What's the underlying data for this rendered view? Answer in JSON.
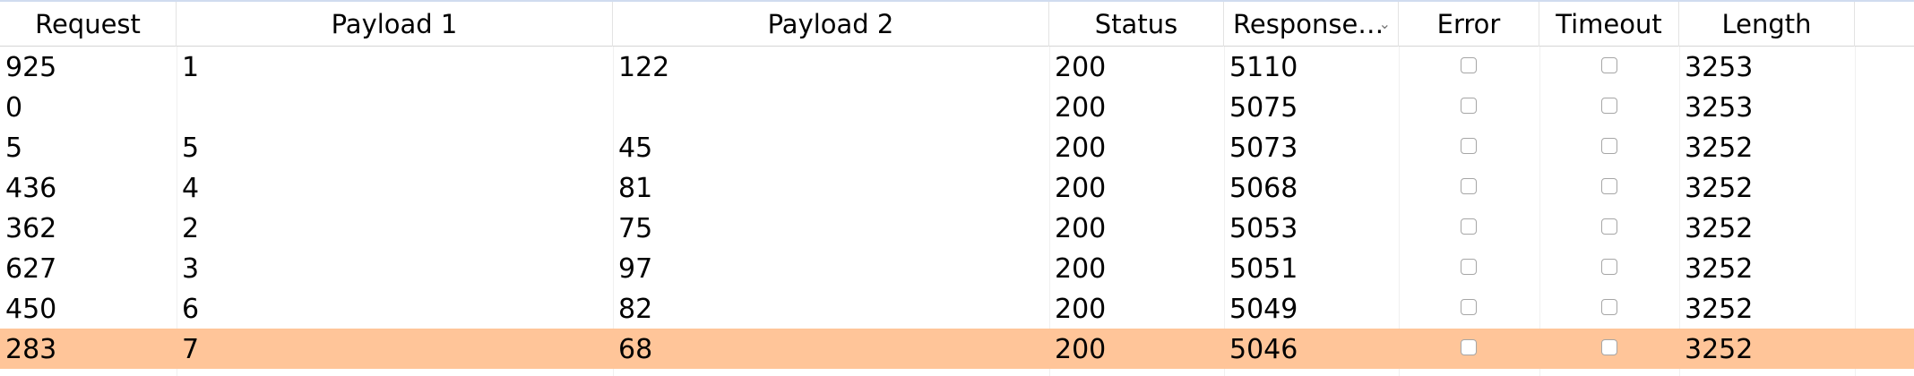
{
  "columns": [
    "Request",
    "Payload 1",
    "Payload 2",
    "Status",
    "Response…",
    "Error",
    "Timeout",
    "Length"
  ],
  "sort_icon": "chevron-down-icon",
  "selected_row_color": "#ffc599",
  "rows": [
    {
      "request": "925",
      "payload1": "1",
      "payload2": "122",
      "status": "200",
      "response": "5110",
      "error": false,
      "timeout": false,
      "length": "3253"
    },
    {
      "request": "0",
      "payload1": "",
      "payload2": "",
      "status": "200",
      "response": "5075",
      "error": false,
      "timeout": false,
      "length": "3253"
    },
    {
      "request": "5",
      "payload1": "5",
      "payload2": "45",
      "status": "200",
      "response": "5073",
      "error": false,
      "timeout": false,
      "length": "3252"
    },
    {
      "request": "436",
      "payload1": "4",
      "payload2": "81",
      "status": "200",
      "response": "5068",
      "error": false,
      "timeout": false,
      "length": "3252"
    },
    {
      "request": "362",
      "payload1": "2",
      "payload2": "75",
      "status": "200",
      "response": "5053",
      "error": false,
      "timeout": false,
      "length": "3252"
    },
    {
      "request": "627",
      "payload1": "3",
      "payload2": "97",
      "status": "200",
      "response": "5051",
      "error": false,
      "timeout": false,
      "length": "3252"
    },
    {
      "request": "450",
      "payload1": "6",
      "payload2": "82",
      "status": "200",
      "response": "5049",
      "error": false,
      "timeout": false,
      "length": "3252"
    },
    {
      "request": "283",
      "payload1": "7",
      "payload2": "68",
      "status": "200",
      "response": "5046",
      "error": false,
      "timeout": false,
      "length": "3252",
      "selected": true
    }
  ]
}
